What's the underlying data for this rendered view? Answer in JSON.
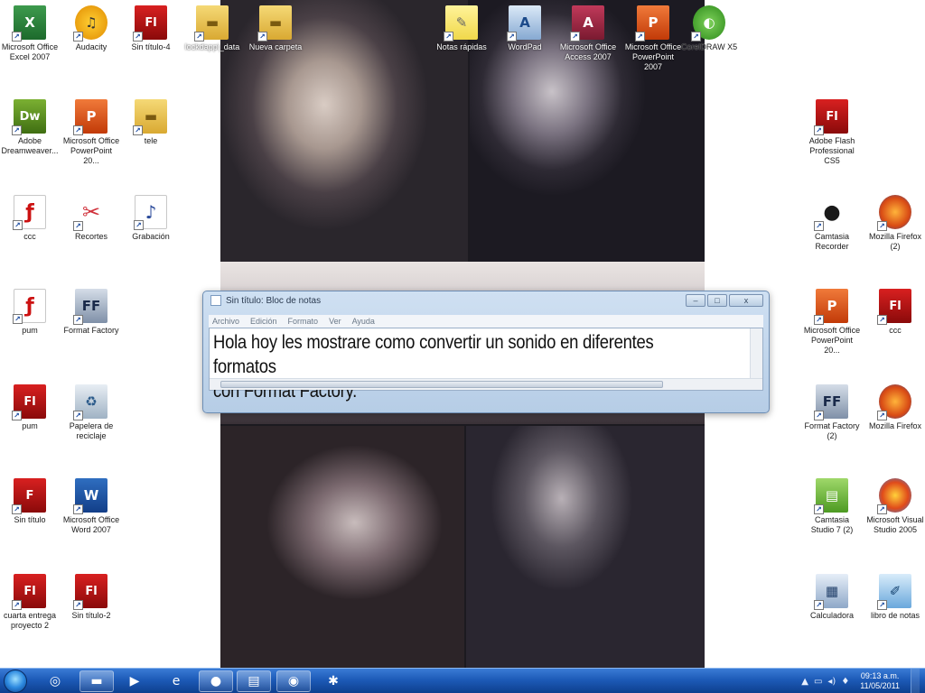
{
  "desktop": {
    "icons": [
      {
        "id": "excel",
        "label": "Microsoft Office Excel 2007",
        "glyph": "X",
        "style": "excel"
      },
      {
        "id": "audacity",
        "label": "Audacity",
        "glyph": "♫",
        "style": "audio"
      },
      {
        "id": "sin-titulo-4",
        "label": "Sin título-4",
        "glyph": "Fl",
        "style": "flash"
      },
      {
        "id": "folder-data",
        "label": "lockdappi_data",
        "glyph": "▬",
        "style": "folder"
      },
      {
        "id": "nueva-carpeta",
        "label": "Nueva carpeta",
        "glyph": "▬",
        "style": "folder"
      },
      {
        "id": "notas-rapidas",
        "label": "Notas rápidas",
        "glyph": "✎",
        "style": "notes"
      },
      {
        "id": "wordpad",
        "label": "WordPad",
        "glyph": "A",
        "style": "wordpad"
      },
      {
        "id": "access",
        "label": "Microsoft Office Access 2007",
        "glyph": "A",
        "style": "access"
      },
      {
        "id": "powerpoint",
        "label": "Microsoft Office PowerPoint 2007",
        "glyph": "P",
        "style": "ppt"
      },
      {
        "id": "corel",
        "label": "CorelDRAW X5",
        "glyph": "◐",
        "style": "corel"
      },
      {
        "id": "dreamweaver",
        "label": "Adobe Dreamweaver...",
        "glyph": "Dw",
        "style": "dw"
      },
      {
        "id": "ppt-2",
        "label": "Microsoft Office PowerPoint 20...",
        "glyph": "P",
        "style": "ppt"
      },
      {
        "id": "tele",
        "label": "tele",
        "glyph": "▬",
        "style": "folder"
      },
      {
        "id": "flash-cs5",
        "label": "Adobe Flash Professional CS5",
        "glyph": "Fl",
        "style": "flash"
      },
      {
        "id": "ccc",
        "label": "ccc",
        "glyph": "ƒ",
        "style": "pdf"
      },
      {
        "id": "recortes",
        "label": "Recortes",
        "glyph": "✂",
        "style": "scissor"
      },
      {
        "id": "grabacion",
        "label": "Grabación",
        "glyph": "♪",
        "style": "music"
      },
      {
        "id": "camtasia-rec",
        "label": "Camtasia Recorder",
        "glyph": "●",
        "style": "cam"
      },
      {
        "id": "firefox-1",
        "label": "Mozilla Firefox (2)",
        "glyph": "",
        "style": "fox"
      },
      {
        "id": "pum-1",
        "label": "pum",
        "glyph": "ƒ",
        "style": "pdf"
      },
      {
        "id": "format-factory",
        "label": "Format Factory",
        "glyph": "FF",
        "style": "ff"
      },
      {
        "id": "ppt-3",
        "label": "Microsoft Office PowerPoint 20...",
        "glyph": "P",
        "style": "ppt"
      },
      {
        "id": "ccc-2",
        "label": "ccc",
        "glyph": "Fl",
        "style": "flash"
      },
      {
        "id": "pum-2",
        "label": "pum",
        "glyph": "Fl",
        "style": "flash"
      },
      {
        "id": "papelera",
        "label": "Papelera de reciclaje",
        "glyph": "♻",
        "style": "recycle"
      },
      {
        "id": "format-factory-2",
        "label": "Format Factory (2)",
        "glyph": "FF",
        "style": "ff"
      },
      {
        "id": "firefox-2",
        "label": "Mozilla Firefox",
        "glyph": "",
        "style": "fox"
      },
      {
        "id": "sin-titulo",
        "label": "Sin título",
        "glyph": "F",
        "style": "flash"
      },
      {
        "id": "word",
        "label": "Microsoft Office Word 2007",
        "glyph": "W",
        "style": "word"
      },
      {
        "id": "camtasia-studio",
        "label": "Camtasia Studio 7 (2)",
        "glyph": "▤",
        "style": "green"
      },
      {
        "id": "visual-studio",
        "label": "Microsoft Visual Studio 2005",
        "glyph": "",
        "style": "vs"
      },
      {
        "id": "cuarta-entrega",
        "label": "cuarta entrega proyecto 2",
        "glyph": "Fl",
        "style": "flash"
      },
      {
        "id": "sin-titulo-2",
        "label": "Sin título-2",
        "glyph": "Fl",
        "style": "flash"
      },
      {
        "id": "calculadora",
        "label": "Calculadora",
        "glyph": "▦",
        "style": "calc"
      },
      {
        "id": "libro-notas",
        "label": "libro de notas",
        "glyph": "✐",
        "style": "book"
      }
    ]
  },
  "notepad": {
    "title": "Sin título: Bloc de notas",
    "menus": [
      "Archivo",
      "Edición",
      "Formato",
      "Ver",
      "Ayuda"
    ],
    "text_line1": "Hola hoy les mostrare como convertir un sonido en diferentes formatos",
    "text_line2": "con Format Factory.",
    "minimize": "–",
    "maximize": "□",
    "close": "x"
  },
  "taskbar": {
    "pinned": [
      {
        "id": "start",
        "glyph": ""
      },
      {
        "id": "ie-search",
        "glyph": "◎"
      },
      {
        "id": "explorer",
        "glyph": "▬"
      },
      {
        "id": "media",
        "glyph": "▶"
      },
      {
        "id": "ie",
        "glyph": "e"
      },
      {
        "id": "firefox",
        "glyph": "●"
      },
      {
        "id": "notepad",
        "glyph": "▤"
      },
      {
        "id": "camtasia",
        "glyph": "◉"
      },
      {
        "id": "app",
        "glyph": "✱"
      }
    ],
    "tray": {
      "arrow": "▲",
      "icons": [
        "▭",
        "◂)",
        "♦"
      ],
      "time": "09:13 a.m.",
      "date": "11/05/2011"
    }
  }
}
